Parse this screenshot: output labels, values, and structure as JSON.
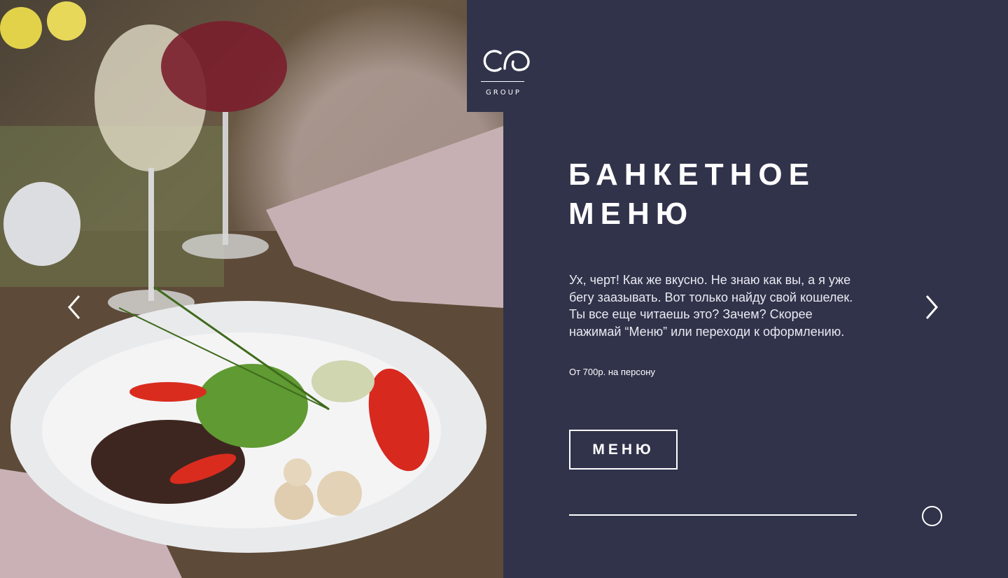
{
  "logo": {
    "text": "GROUP",
    "icon": "cg-logo-icon"
  },
  "hero": {
    "title": "БАНКЕТНОЕ МЕНЮ",
    "description": "Ух, черт! Как же вкусно. Не знаю как вы, а я уже бегу заазывать. Вот только найду свой кошелек. Ты все еще читаешь это? Зачем? Скорее нажимай “Меню” или переходи к оформлению.",
    "price": "От 700р. на персону",
    "button_label": "МЕНЮ"
  },
  "navigation": {
    "prev_icon": "chevron-left-icon",
    "next_icon": "chevron-right-icon",
    "pager_icon": "circle-icon"
  },
  "colors": {
    "panel": "#31334b",
    "text": "#ffffff"
  }
}
